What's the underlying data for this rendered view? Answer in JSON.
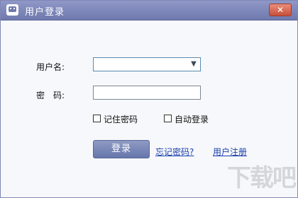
{
  "window": {
    "title": "用户登录",
    "close_label": "✕"
  },
  "form": {
    "username_label": "用户名:",
    "password_label": "密　码:",
    "username_value": "",
    "password_value": "",
    "remember_label": "记住密码",
    "autologin_label": "自动登录",
    "remember_checked": false,
    "autologin_checked": false
  },
  "actions": {
    "login_label": "登录",
    "forgot_label": "忘记密码?",
    "register_label": "用户注册"
  },
  "watermark": {
    "text": "下载吧"
  },
  "icons": {
    "app": "app-icon",
    "dropdown": "chevron-down-icon",
    "close": "close-icon"
  },
  "colors": {
    "titlebar": "#6f79ad",
    "link": "#1a3fae",
    "button": "#6776ab",
    "close": "#c74f3b"
  }
}
